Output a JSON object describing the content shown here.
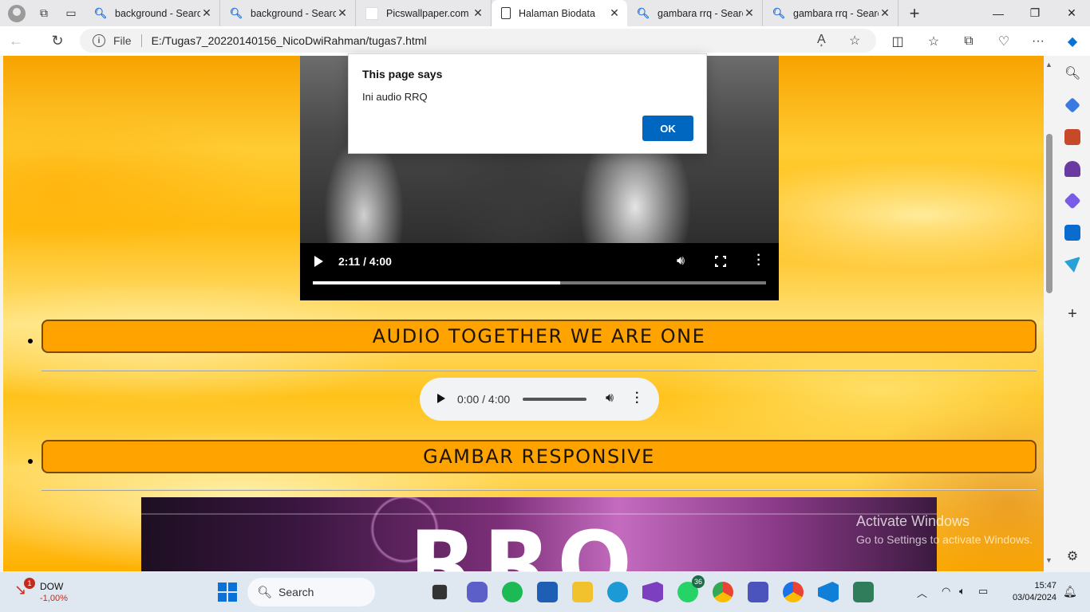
{
  "tabs": [
    {
      "title": "background - Searc",
      "fav": "search-icon"
    },
    {
      "title": "background - Searc",
      "fav": "search-icon"
    },
    {
      "title": "Picswallpaper.com",
      "fav": "blank-page-icon"
    },
    {
      "title": "Halaman Biodata",
      "fav": "page-icon",
      "active": true
    },
    {
      "title": "gambara rrq - Searc",
      "fav": "search-icon"
    },
    {
      "title": "gambara rrq - Searc",
      "fav": "search-icon"
    }
  ],
  "address": {
    "scheme_label": "File",
    "url": "E:/Tugas7_20220140156_NicoDwiRahman/tugas7.html"
  },
  "alert": {
    "title": "This page says",
    "message": "Ini audio RRQ",
    "ok_label": "OK"
  },
  "video": {
    "time": "2:11 / 4:00",
    "progress": 0.546
  },
  "sections": [
    {
      "heading": "AUDIO TOGETHER WE ARE ONE"
    },
    {
      "heading": "GAMBAR RESPONSIVE"
    }
  ],
  "audio": {
    "time": "0:00 / 4:00",
    "progress": 0
  },
  "banner": {
    "logo_text": "RRQ"
  },
  "watermark": {
    "line1": "Activate Windows",
    "line2": "Go to Settings to activate Windows."
  },
  "taskbar": {
    "stock_name": "DOW",
    "stock_change": "-1,00%",
    "stock_badge": "1",
    "search_placeholder": "Search",
    "whatsapp_badge": "36",
    "time": "15:47",
    "date": "03/04/2024"
  },
  "colors": {
    "heading_bg": "#ffa300",
    "ok_button": "#0067c0",
    "stock_red": "#c42b1c"
  }
}
